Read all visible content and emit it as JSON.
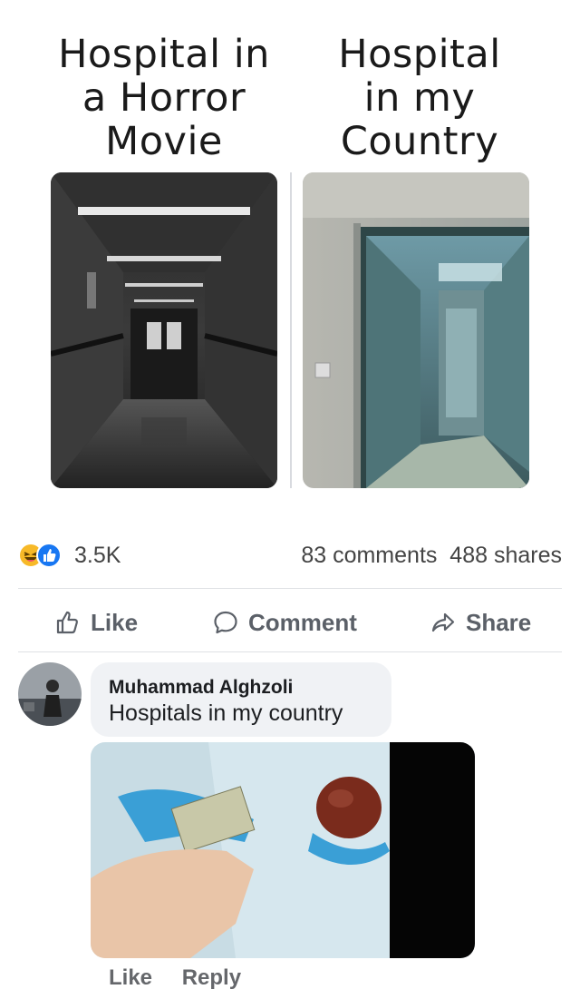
{
  "meme": {
    "left_caption": "Hospital in\na Horror\nMovie",
    "right_caption": "Hospital\nin my\nCountry"
  },
  "post_stats": {
    "reaction_count": "3.5K",
    "comments": "83 comments",
    "shares": "488 shares"
  },
  "actions": {
    "like": "Like",
    "comment": "Comment",
    "share": "Share"
  },
  "comment": {
    "author": "Muhammad Alghzoli",
    "text": "Hospitals in my country",
    "like": "Like",
    "reply": "Reply"
  },
  "icons": {
    "reactions": [
      "haha-icon",
      "like-reaction-icon"
    ],
    "action_like": "thumbs-up-icon",
    "action_comment": "speech-bubble-icon",
    "action_share": "share-arrow-icon"
  },
  "colors": {
    "like_blue": "#1877f2",
    "haha_yellow": "#f7b928",
    "action_gray": "#5b6068",
    "bubble_bg": "#f0f2f5"
  }
}
